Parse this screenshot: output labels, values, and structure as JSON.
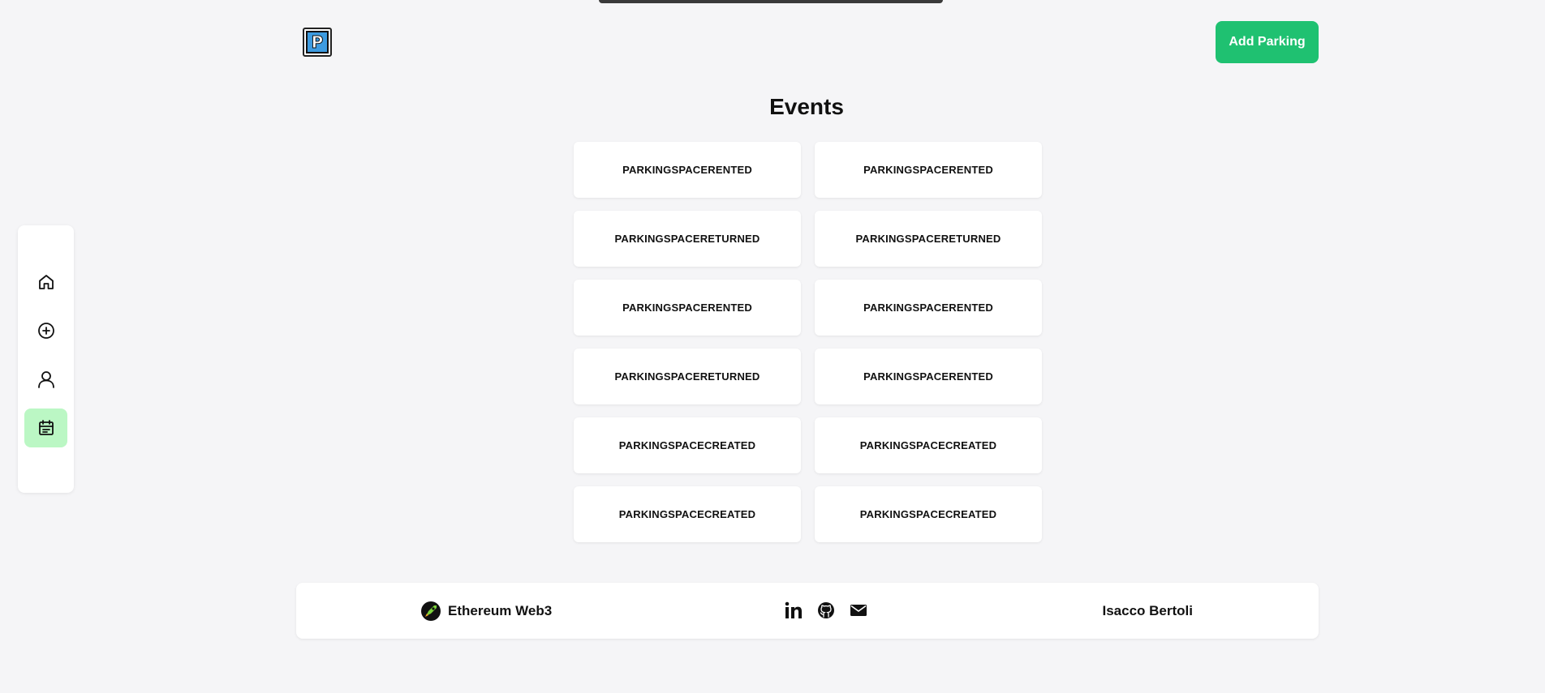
{
  "header": {
    "logo_letter": "P",
    "add_button_label": "Add Parking"
  },
  "sidebar": {
    "items": [
      {
        "name": "home",
        "icon": "home-icon",
        "active": false
      },
      {
        "name": "add",
        "icon": "plus-circle-icon",
        "active": false
      },
      {
        "name": "profile",
        "icon": "user-icon",
        "active": false
      },
      {
        "name": "events",
        "icon": "calendar-icon",
        "active": true
      }
    ],
    "active_color": "#bbf7c4"
  },
  "main": {
    "title": "Events",
    "events": [
      "PARKINGSPACERENTED",
      "PARKINGSPACERENTED",
      "PARKINGSPACERETURNED",
      "PARKINGSPACERETURNED",
      "PARKINGSPACERENTED",
      "PARKINGSPACERENTED",
      "PARKINGSPACERETURNED",
      "PARKINGSPACERENTED",
      "PARKINGSPACECREATED",
      "PARKINGSPACECREATED",
      "PARKINGSPACECREATED",
      "PARKINGSPACECREATED"
    ]
  },
  "footer": {
    "brand_label": "Ethereum Web3",
    "brand_icon": "rocket-icon",
    "social": [
      "linkedin-icon",
      "github-icon",
      "mail-icon"
    ],
    "author": "Isacco Bertoli"
  },
  "colors": {
    "accent": "#1fc171",
    "background": "#f5f5f7"
  }
}
